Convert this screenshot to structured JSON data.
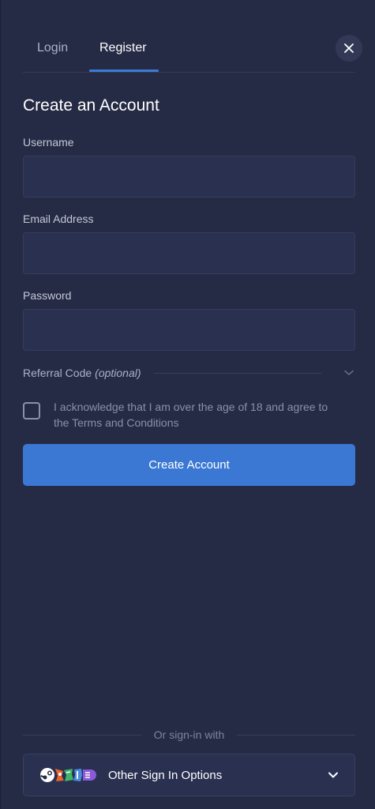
{
  "tabs": [
    {
      "label": "Login",
      "active": false
    },
    {
      "label": "Register",
      "active": true
    }
  ],
  "close_icon": "close-icon",
  "form": {
    "title": "Create an Account",
    "username_label": "Username",
    "username_value": "",
    "email_label": "Email Address",
    "email_value": "",
    "password_label": "Password",
    "password_value": "",
    "referral_label": "Referral Code",
    "referral_optional": "(optional)",
    "acknowledge_text": "I acknowledge that I am over the age of 18 and agree to the Terms and Conditions",
    "acknowledge_checked": false,
    "submit_label": "Create Account"
  },
  "alt_signin": {
    "divider_text": "Or sign-in with",
    "button_label": "Other Sign In Options",
    "provider_icons": [
      "steam-icon",
      "provider-icon-orange",
      "provider-icon-green",
      "provider-icon-blue",
      "provider-icon-purple"
    ]
  },
  "colors": {
    "background": "#262b45",
    "input_background": "#2a3050",
    "accent": "#3a78d4",
    "tab_active_underline": "#3a7bd5"
  }
}
